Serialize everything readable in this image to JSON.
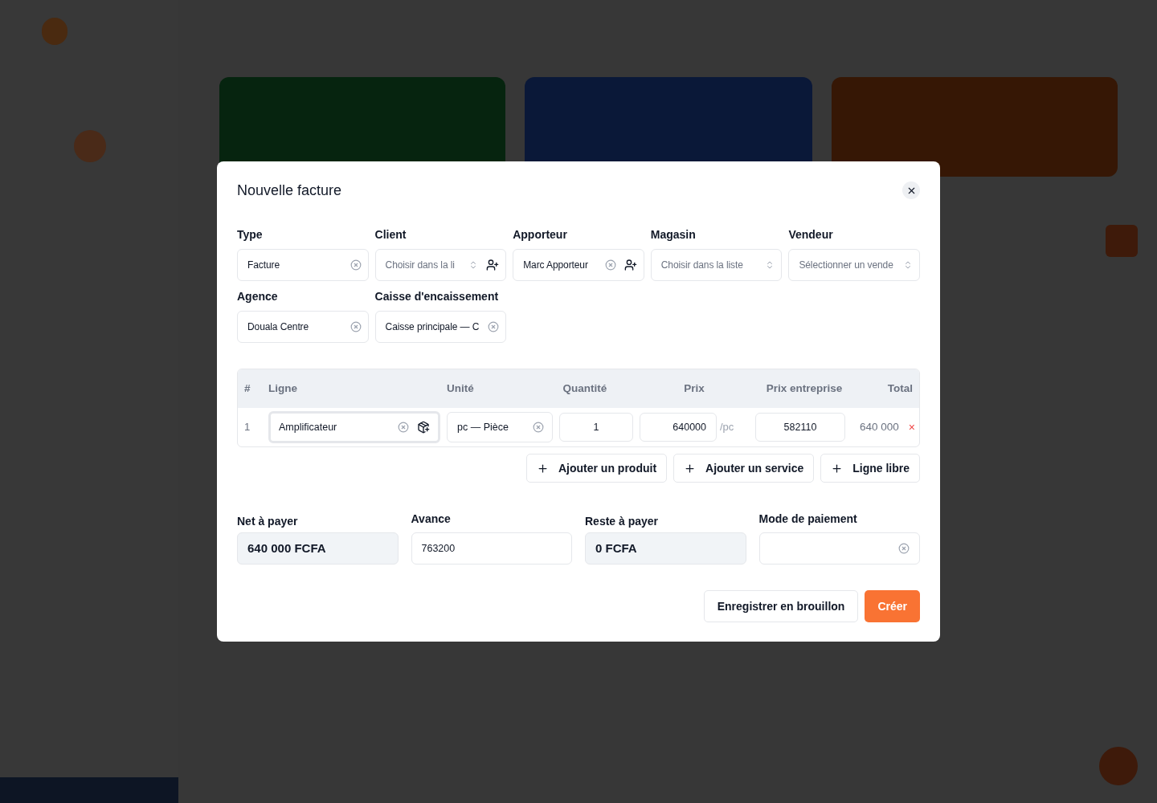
{
  "dialog": {
    "title": "Nouvelle facture",
    "fields": [
      {
        "label": "Type",
        "value": "Facture",
        "kind": "clearable"
      },
      {
        "label": "Client",
        "placeholder": "Choisir dans la li",
        "kind": "picker_add"
      },
      {
        "label": "Apporteur",
        "value": "Marc Apporteur",
        "kind": "clearable_add"
      },
      {
        "label": "Magasin",
        "placeholder": "Choisir dans la liste",
        "kind": "picker"
      },
      {
        "label": "Vendeur",
        "placeholder": "Sélectionner un vende",
        "kind": "picker"
      },
      {
        "label": "Agence",
        "value": "Douala Centre",
        "kind": "clearable"
      },
      {
        "label": "Caisse d'encaissement",
        "value": "Caisse principale — C",
        "kind": "clearable"
      }
    ],
    "table": {
      "columns": [
        "#",
        "Ligne",
        "Unité",
        "Quantité",
        "Prix",
        "Prix entreprise",
        "Total"
      ],
      "rows": [
        {
          "index": "1",
          "line": "Amplificateur",
          "unit": "pc — Pièce",
          "quantity": "1",
          "price": "640000",
          "price_unit": "/pc",
          "company_price": "582110",
          "total": "640 000",
          "remove": "×"
        }
      ]
    },
    "add_buttons": [
      "Ajouter un produit",
      "Ajouter un service",
      "Ligne libre"
    ],
    "totals": [
      {
        "label": "Net à payer",
        "value": "640 000 FCFA",
        "kind": "readonly"
      },
      {
        "label": "Avance",
        "value": "763200",
        "kind": "input"
      },
      {
        "label": "Reste à payer",
        "value": "0 FCFA",
        "kind": "readonly"
      },
      {
        "label": "Mode de paiement",
        "kind": "select"
      }
    ],
    "actions": [
      {
        "label": "Enregistrer en brouillon",
        "kind": "secondary"
      },
      {
        "label": "Créer",
        "kind": "primary"
      }
    ]
  }
}
